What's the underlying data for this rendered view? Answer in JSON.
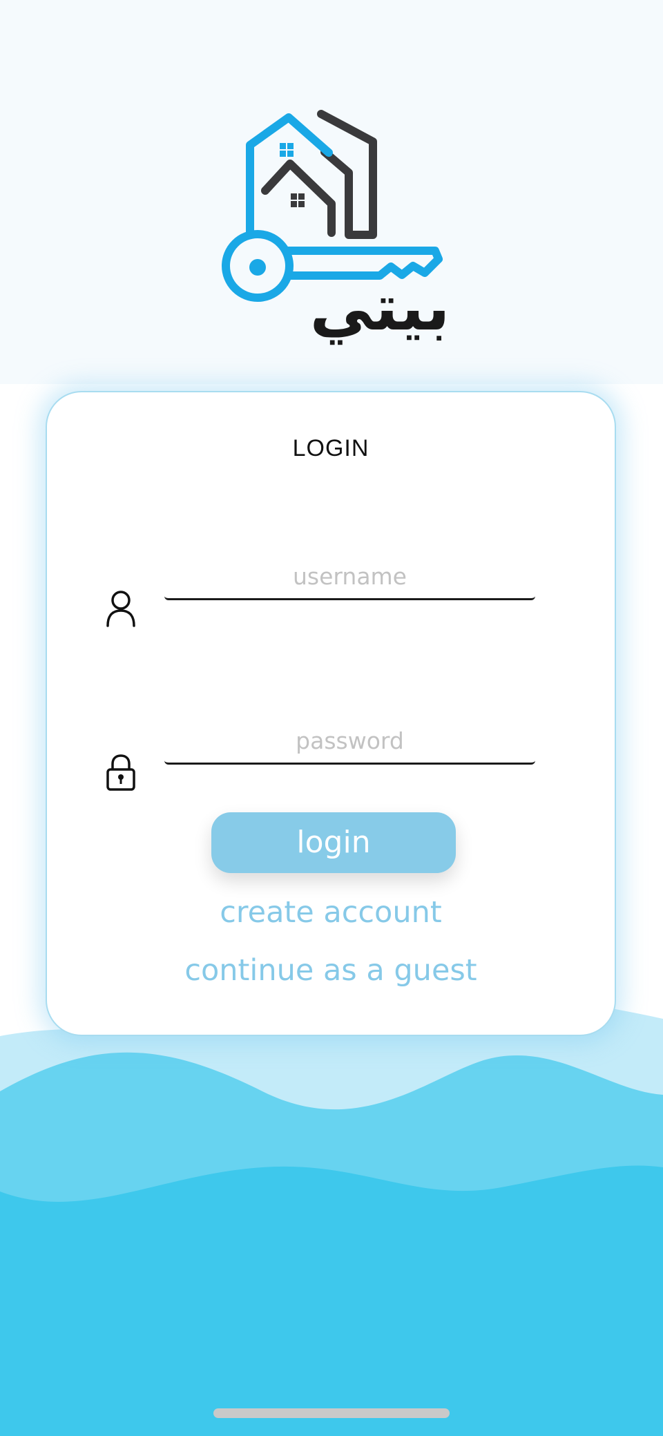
{
  "brand": {
    "logo_text": "بيتي",
    "colors": {
      "key_blue": "#1aa8e6",
      "house_dark": "#3a3a3c"
    }
  },
  "login_card": {
    "title": "LOGIN",
    "username": {
      "icon": "user-icon",
      "placeholder": "username",
      "value": ""
    },
    "password": {
      "icon": "lock-icon",
      "placeholder": "password",
      "value": ""
    },
    "login_label": "login",
    "create_account_label": "create account",
    "guest_label": "continue as a guest"
  },
  "theme": {
    "accent": "#87cbe8",
    "link": "#86c9e8",
    "wave_light": "#c3ebf9",
    "wave_mid": "#67d3f0",
    "wave_dark": "#3ec8ec"
  }
}
